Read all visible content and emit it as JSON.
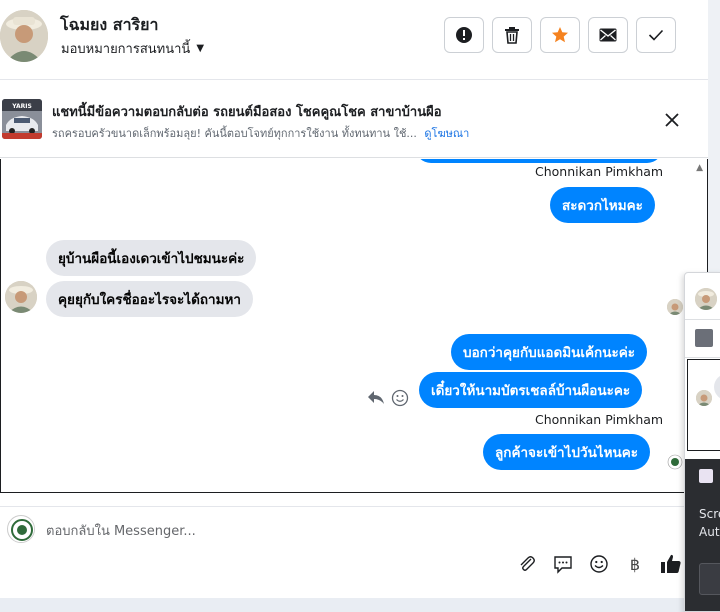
{
  "header": {
    "contact_name": "โฉมยง สาริยา",
    "assign_label": "มอบหมายการสนทนานี้"
  },
  "header_actions": [
    {
      "name": "spam-button",
      "icon": "alert-icon"
    },
    {
      "name": "delete-button",
      "icon": "trash-icon"
    },
    {
      "name": "star-button",
      "icon": "star-icon"
    },
    {
      "name": "mark-unread-button",
      "icon": "envelope-icon"
    },
    {
      "name": "mark-done-button",
      "icon": "check-icon"
    }
  ],
  "ad": {
    "title": "แชทนี้มีข้อความตอบกลับต่อ รถยนต์มือสอง โชคคูณโชค สาขาบ้านผือ",
    "subtitle": "รถครอบครัวขนาดเล็กพร้อมลุย! คันนี้ตอบโจทย์ทุกการใช้งาน ทั้งทนทาน ใช้...",
    "link_label": "ดูโฆษณา",
    "thumb_text": "YARIS"
  },
  "chat": {
    "sender_top": "Chonnikan Pimkham",
    "messages_out_1": "สะดวกไหมคะ",
    "messages_in_1": "ยุบ้านผือนี้เองเดวเข้าไปชมนะค่ะ",
    "messages_in_2": "คุยยุกับใครชื่ออะไรจะได้ถามหา",
    "messages_out_2": "บอกว่าคุยกับแอดมินเค้กนะค่ะ",
    "messages_out_3": "เดี๋ยวให้นามบัตรเชลล์บ้านผือนะคะ",
    "sender_bottom": "Chonnikan Pimkham",
    "messages_out_4": "ลูกค้าจะเข้าไปวันไหนคะ"
  },
  "composer": {
    "placeholder": "ตอบกลับใน Messenger..."
  },
  "composer_tools": [
    {
      "name": "attach-button",
      "icon": "paperclip-icon"
    },
    {
      "name": "saved-replies-button",
      "icon": "chat-bubble-icon"
    },
    {
      "name": "emoji-button",
      "icon": "smiley-icon"
    },
    {
      "name": "payment-button",
      "icon": "baht-icon",
      "glyph": "฿"
    },
    {
      "name": "like-button",
      "icon": "thumbs-up-icon"
    }
  ],
  "overlay": {
    "line1": "Scre",
    "line2": "Aut"
  },
  "colors": {
    "outgoing_bubble": "#0084ff",
    "incoming_bubble": "#e4e6eb",
    "star": "#f5821f",
    "link": "#1b74e4"
  }
}
